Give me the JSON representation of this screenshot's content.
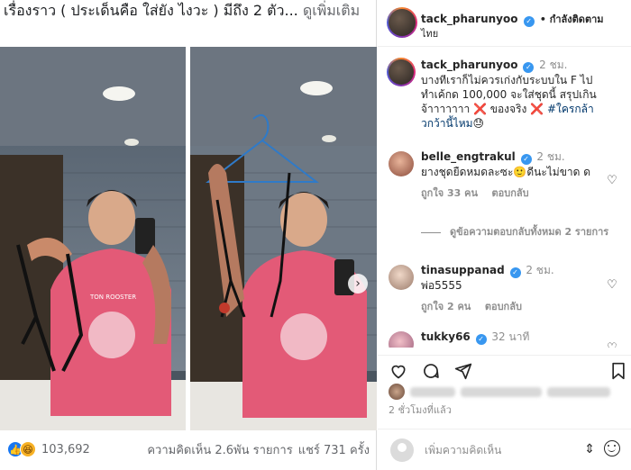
{
  "facebook": {
    "caption_text": "เรื่องราว ( ประเด็นคือ ใส่ยัง ไงวะ ) มีถึง 2 ตัว... ",
    "caption_more": "ดูเพิ่มเติม",
    "reaction_icons": [
      "like-icon",
      "haha-icon"
    ],
    "reaction_count": "103,692",
    "comments_stat": "ความคิดเห็น 2.6พัน รายการ",
    "shares_stat": "แชร์ 731 ครั้ง",
    "photo_shirt_print": "TON ROOSTER"
  },
  "instagram": {
    "header": {
      "username": "tack_pharunyoo",
      "follow_status": "• กำลังติดตาม",
      "location": "ไทย"
    },
    "caption": {
      "username": "tack_pharunyoo",
      "time": "2 ชม.",
      "text": "บางทีเราก็ไม่ควรเก่งกับระบบใน F ไป ทำเค้กด 100,000 จะใส่ชุดนี้ สรุปเกิน จ้าาาาาาา ❌ ของจริง ❌ ",
      "hashtag": "#ใครกล้าวกว้านี้ไหม",
      "emoji": "😓"
    },
    "comments": [
      {
        "username": "belle_engtrakul",
        "time": "2 ชม.",
        "text": "ยางชุดยืดหมดละซะ🙂ดีนะไม่ขาด ด",
        "likes": "ถูกใจ 33 คน",
        "reply": "ตอบกลับ"
      },
      {
        "username": "tinasuppanad",
        "time": "2 ชม.",
        "text": "พ่อ5555",
        "likes": "ถูกใจ 2 คน",
        "reply": "ตอบกลับ"
      },
      {
        "username": "tukky66",
        "time": "32 นาที",
        "text": ""
      }
    ],
    "view_replies": "ดูข้อความตอบกลับทั้งหมด 2 รายการ",
    "posted_ago": "2 ชั่วโมงที่แล้ว",
    "add_comment_placeholder": "เพิ่มความคิดเห็น",
    "emoji_symbol": "☺"
  }
}
